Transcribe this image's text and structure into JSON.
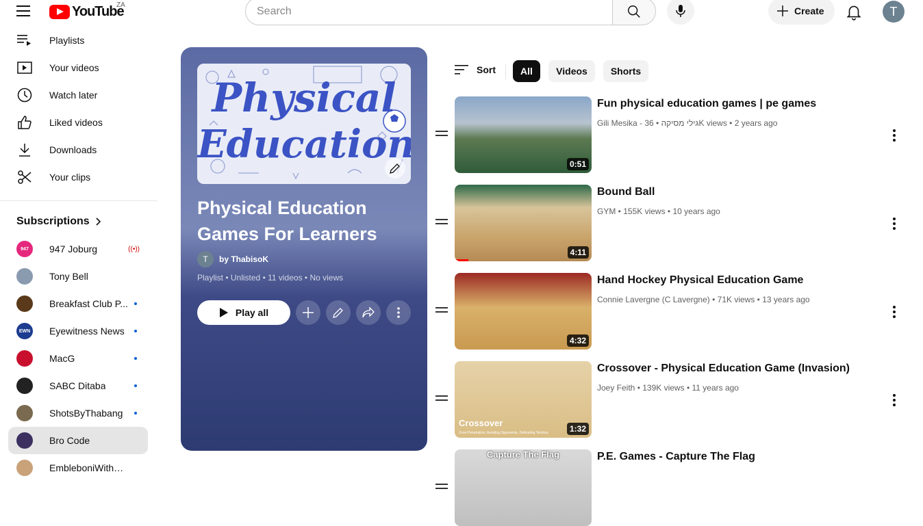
{
  "header": {
    "logo_text": "YouTube",
    "country_code": "ZA",
    "search_placeholder": "Search",
    "create_label": "Create",
    "avatar_initial": "T"
  },
  "sidebar": {
    "items": [
      {
        "label": "Playlists",
        "icon": "playlists-icon"
      },
      {
        "label": "Your videos",
        "icon": "your-videos-icon"
      },
      {
        "label": "Watch later",
        "icon": "clock-icon"
      },
      {
        "label": "Liked videos",
        "icon": "thumbs-up-icon"
      },
      {
        "label": "Downloads",
        "icon": "download-icon"
      },
      {
        "label": "Your clips",
        "icon": "scissors-icon"
      }
    ],
    "subscriptions_title": "Subscriptions",
    "subscriptions": [
      {
        "name": "947 Joburg",
        "badge": "live",
        "avatar_text": "947",
        "color": "#e5287d"
      },
      {
        "name": "Tony Bell",
        "badge": "",
        "avatar_text": "",
        "color": "#8a9bb0"
      },
      {
        "name": "Breakfast Club P...",
        "badge": "dot",
        "avatar_text": "",
        "color": "#5a3a1a"
      },
      {
        "name": "Eyewitness News",
        "badge": "dot",
        "avatar_text": "EWN",
        "color": "#1b3c8f"
      },
      {
        "name": "MacG",
        "badge": "dot",
        "avatar_text": "",
        "color": "#c8102e"
      },
      {
        "name": "SABC Ditaba",
        "badge": "dot",
        "avatar_text": "",
        "color": "#222222"
      },
      {
        "name": "ShotsByThabang",
        "badge": "dot",
        "avatar_text": "",
        "color": "#7a6a50"
      },
      {
        "name": "Bro Code",
        "badge": "",
        "avatar_text": "",
        "color": "#3b3060"
      },
      {
        "name": "EmbleboniWithOph",
        "badge": "",
        "avatar_text": "",
        "color": "#c9a27a"
      }
    ]
  },
  "playlist": {
    "thumb_line1": "Physical",
    "thumb_line2": "Education",
    "title": "Physical Education Games For Learners",
    "owner_initial": "T",
    "owner": "by ThabisoK",
    "meta": "Playlist • Unlisted • 11 videos • No views",
    "play_all_label": "Play all"
  },
  "filters": {
    "sort_label": "Sort",
    "chips": [
      "All",
      "Videos",
      "Shorts"
    ],
    "selected": "All"
  },
  "videos": [
    {
      "title": "Fun physical education games | pe games",
      "channel": "Gili Mesika - גילי מסיקה",
      "views": "36K views",
      "age": "2 years ago",
      "duration": "0:51",
      "progress": 0
    },
    {
      "title": "Bound Ball",
      "channel": "GYM",
      "views": "155K views",
      "age": "10 years ago",
      "duration": "4:11",
      "progress": 0.1
    },
    {
      "title": "Hand Hockey Physical Education Game",
      "channel": "Connie Lavergne (C Lavergne)",
      "views": "71K views",
      "age": "13 years ago",
      "duration": "4:32",
      "progress": 0
    },
    {
      "title": "Crossover - Physical Education Game (Invasion)",
      "channel": "Joey Feith",
      "views": "139K views",
      "age": "11 years ago",
      "duration": "1:32",
      "progress": 0,
      "overlay_title": "Crossover",
      "overlay_sub": "Zone Penetration, Avoiding Opponents, Defending Territory"
    },
    {
      "title": "P.E. Games - Capture The Flag",
      "channel": "",
      "views": "",
      "age": "",
      "duration": "",
      "progress": 0,
      "overlay_title": "Capture The Flag"
    }
  ]
}
